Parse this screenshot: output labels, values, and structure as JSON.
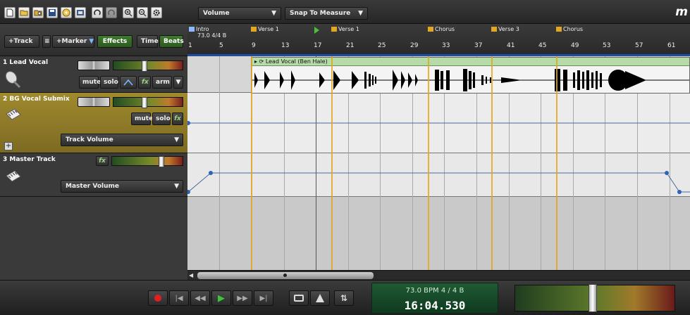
{
  "toolbar": {
    "icons": [
      "new-file-icon",
      "open-folder-icon",
      "open-recent-icon",
      "save-icon",
      "burn-cd-icon",
      "export-icon",
      "loop-icon",
      "loop-disabled-icon",
      "zoom-in-icon",
      "zoom-out-icon",
      "settings-icon"
    ],
    "view_select": "Volume",
    "snap_select": "Snap To Measure",
    "logo": "m"
  },
  "left_header": {
    "add_track": "+Track",
    "add_marker": "+Marker",
    "effects": "Effects",
    "time": "Time",
    "beats": "Beats"
  },
  "tracks": [
    {
      "name": "1 Lead Vocal",
      "icon": "microphone-icon",
      "mute": "mute",
      "solo": "solo",
      "fx": "fx",
      "arm": "arm"
    },
    {
      "name": "2 BG Vocal Submix",
      "icon": "keyboard-icon",
      "mute": "mute",
      "solo": "solo",
      "fx": "fx",
      "automation": "Track Volume"
    },
    {
      "name": "3 Master Track",
      "icon": "keyboard-icon",
      "fx": "fx",
      "automation": "Master Volume"
    }
  ],
  "ruler": {
    "markers": [
      "Intro",
      "Verse 1",
      "Verse 1",
      "Chorus",
      "Verse 3",
      "Chorus"
    ],
    "intro_info": "73.0 4/4 B",
    "bars": [
      "1",
      "5",
      "9",
      "13",
      "17",
      "21",
      "25",
      "29",
      "33",
      "37",
      "41",
      "45",
      "49",
      "53",
      "57",
      "61"
    ]
  },
  "clip": {
    "title": "Lead Vocal (Ben Hale)"
  },
  "transport": {
    "bpm": "73.0 BPM  4 / 4  B",
    "clock": "16:04.530"
  },
  "colors": {
    "marker": "#e0a81e",
    "clip_header": "#b7dba8",
    "display": "#1f5a34",
    "selected_track": "#a08a2e"
  }
}
